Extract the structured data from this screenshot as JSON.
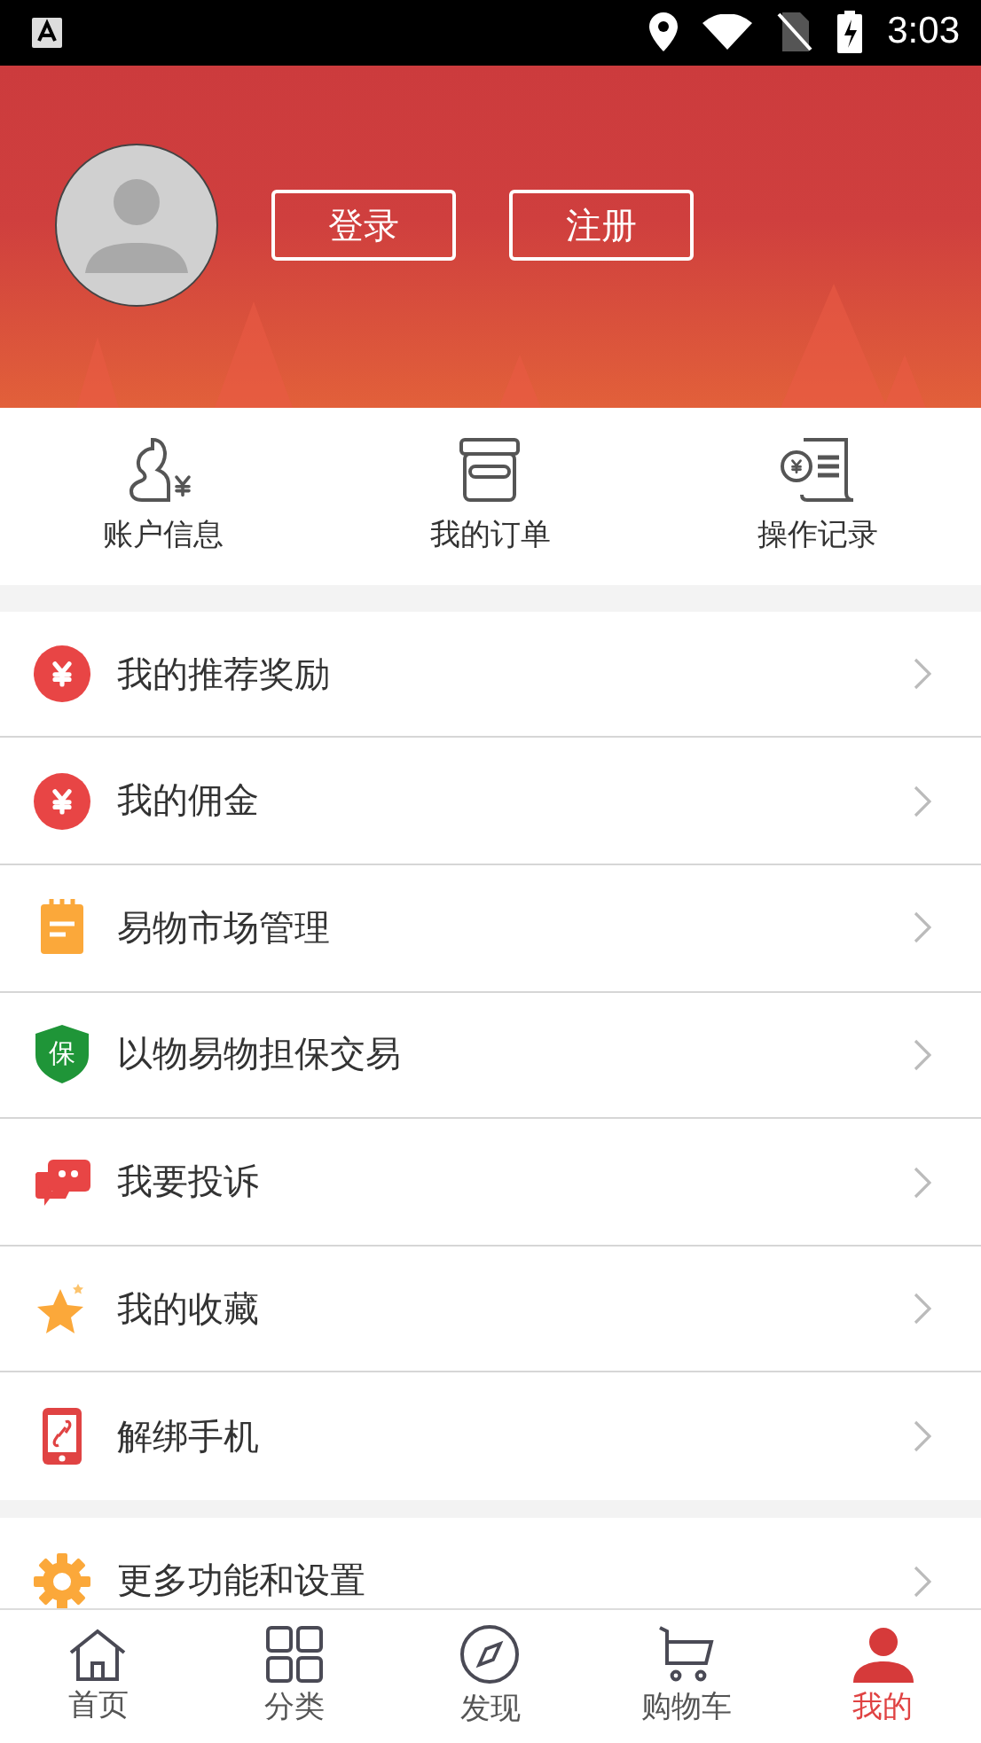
{
  "status_bar": {
    "time": "3:03"
  },
  "header": {
    "buttons": [
      "登录",
      "注册"
    ]
  },
  "shortcuts": [
    {
      "kind": "account",
      "label": "账户信息"
    },
    {
      "kind": "orders",
      "label": "我的订单"
    },
    {
      "kind": "records",
      "label": "操作记录"
    }
  ],
  "menu_sections": [
    {
      "items": [
        {
          "kind": "yuan",
          "label": "我的推荐奖励"
        },
        {
          "kind": "yuan",
          "label": "我的佣金"
        },
        {
          "kind": "notepad",
          "label": "易物市场管理"
        },
        {
          "kind": "shield",
          "badge": "保",
          "label": "以物易物担保交易"
        },
        {
          "kind": "complaint",
          "label": "我要投诉"
        },
        {
          "kind": "star",
          "label": "我的收藏"
        },
        {
          "kind": "phone",
          "label": "解绑手机"
        }
      ]
    },
    {
      "items": [
        {
          "kind": "gear",
          "label": "更多功能和设置"
        }
      ]
    }
  ],
  "tab_bar": [
    {
      "kind": "home",
      "label": "首页",
      "selected": false
    },
    {
      "kind": "grid",
      "label": "分类",
      "selected": false
    },
    {
      "kind": "compass",
      "label": "发现",
      "selected": false
    },
    {
      "kind": "cart",
      "label": "购物车",
      "selected": false
    },
    {
      "kind": "person",
      "label": "我的",
      "selected": true
    }
  ]
}
